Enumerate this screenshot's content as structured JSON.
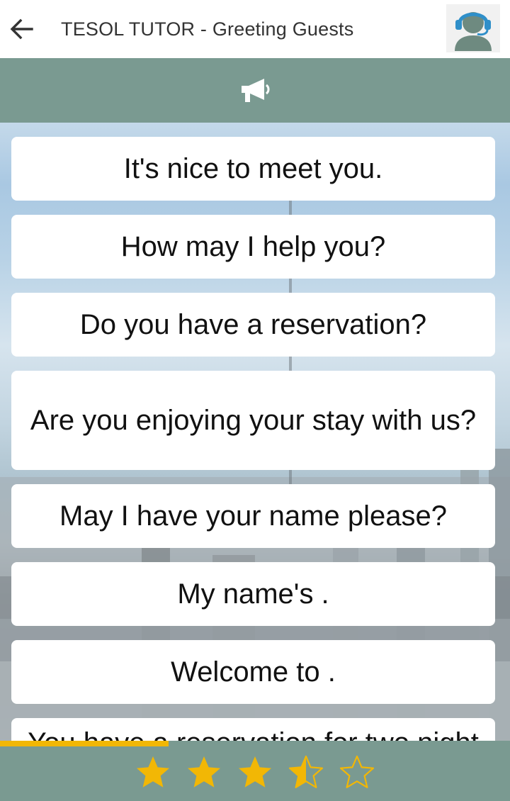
{
  "app_bar": {
    "title": "TESOL TUTOR - Greeting Guests",
    "back_icon": "arrow-left-icon",
    "avatar_icon": "support-agent-icon"
  },
  "audio_bar": {
    "icon": "megaphone-icon"
  },
  "phrases": [
    "It's nice to meet you.",
    "How may I help you?",
    "Do you have a reservation?",
    "Are you enjoying your stay with us?",
    "May I have your name please?",
    "My name's .",
    "Welcome to ."
  ],
  "partial_phrase": "You have a reservation for two night",
  "progress": {
    "fraction": 0.33
  },
  "rating": {
    "value": 3.5,
    "max": 5
  },
  "colors": {
    "bar": "#7a9a91",
    "star": "#f2b705",
    "progress": "#f2b705",
    "card": "#ffffff",
    "text": "#111111"
  }
}
